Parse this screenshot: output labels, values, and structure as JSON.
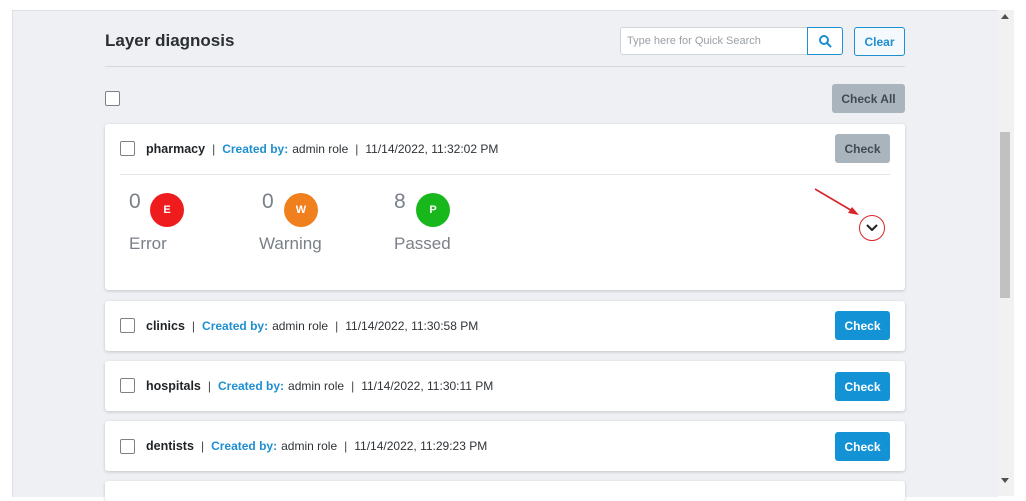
{
  "header": {
    "title": "Layer diagnosis",
    "search_placeholder": "Type here for Quick Search",
    "search_icon": "search-icon",
    "clear_label": "Clear"
  },
  "toolbar": {
    "check_all_label": "Check All"
  },
  "layers": [
    {
      "name": "pharmacy",
      "created_by_label": "Created by:",
      "created_by": "admin role",
      "timestamp": "11/14/2022, 11:32:02 PM",
      "check_label": "Check",
      "check_enabled": false,
      "expanded": true,
      "stats": [
        {
          "count": "0",
          "badge": "E",
          "label": "Error",
          "color": "#ee1c1c"
        },
        {
          "count": "0",
          "badge": "W",
          "label": "Warning",
          "color": "#f07f1e"
        },
        {
          "count": "8",
          "badge": "P",
          "label": "Passed",
          "color": "#18b81d"
        }
      ]
    },
    {
      "name": "clinics",
      "created_by_label": "Created by:",
      "created_by": "admin role",
      "timestamp": "11/14/2022, 11:30:58 PM",
      "check_label": "Check",
      "check_enabled": true
    },
    {
      "name": "hospitals",
      "created_by_label": "Created by:",
      "created_by": "admin role",
      "timestamp": "11/14/2022, 11:30:11 PM",
      "check_label": "Check",
      "check_enabled": true
    },
    {
      "name": "dentists",
      "created_by_label": "Created by:",
      "created_by": "admin role",
      "timestamp": "11/14/2022, 11:29:23 PM",
      "check_label": "Check",
      "check_enabled": true
    }
  ],
  "colors": {
    "accent": "#1492d6",
    "disabled_button": "#a9b4bd",
    "annotation": "#d7262b"
  }
}
